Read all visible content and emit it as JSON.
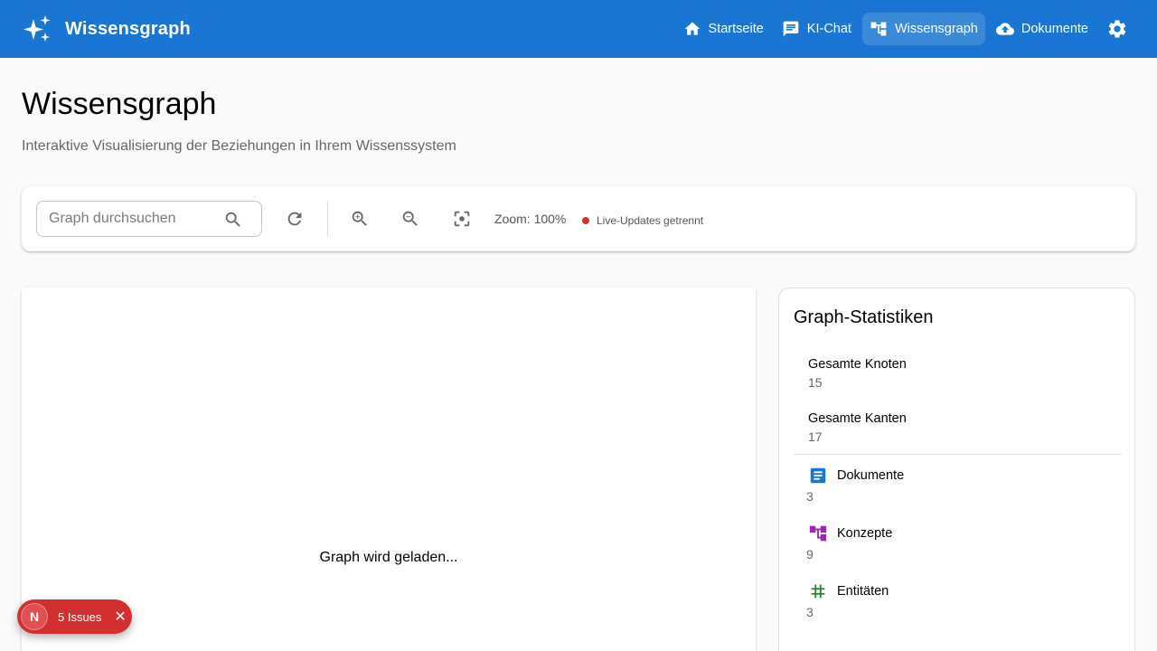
{
  "app": {
    "title": "Wissensgraph",
    "brand_icon": "sparkles-icon"
  },
  "nav": {
    "items": [
      {
        "label": "Startseite",
        "icon": "home-icon",
        "active": false
      },
      {
        "label": "KI-Chat",
        "icon": "chat-icon",
        "active": false
      },
      {
        "label": "Wissensgraph",
        "icon": "graph-icon",
        "active": true
      },
      {
        "label": "Dokumente",
        "icon": "cloud-upload-icon",
        "active": false
      }
    ],
    "settings_icon": "gear-icon"
  },
  "page": {
    "title": "Wissensgraph",
    "subtitle": "Interaktive Visualisierung der Beziehungen in Ihrem Wissenssystem"
  },
  "toolbar": {
    "search_placeholder": "Graph durchsuchen",
    "zoom_label": "Zoom: 100%",
    "live_status": "Live-Updates getrennt",
    "live_status_color": "#d32f2f"
  },
  "graph": {
    "loading_text": "Graph wird geladen..."
  },
  "stats": {
    "title": "Graph-Statistiken",
    "totals": [
      {
        "label": "Gesamte Knoten",
        "value": "15"
      },
      {
        "label": "Gesamte Kanten",
        "value": "17"
      }
    ],
    "categories": [
      {
        "label": "Dokumente",
        "value": "3",
        "icon": "document-icon",
        "color": "#1976d2"
      },
      {
        "label": "Konzepte",
        "value": "9",
        "icon": "concept-icon",
        "color": "#9c27b0"
      },
      {
        "label": "Entitäten",
        "value": "3",
        "icon": "hash-icon",
        "color": "#2e7d32"
      }
    ]
  },
  "issues": {
    "logo": "N",
    "label": "5 Issues"
  },
  "colors": {
    "primary": "#1976d2",
    "error": "#d32f2f"
  }
}
